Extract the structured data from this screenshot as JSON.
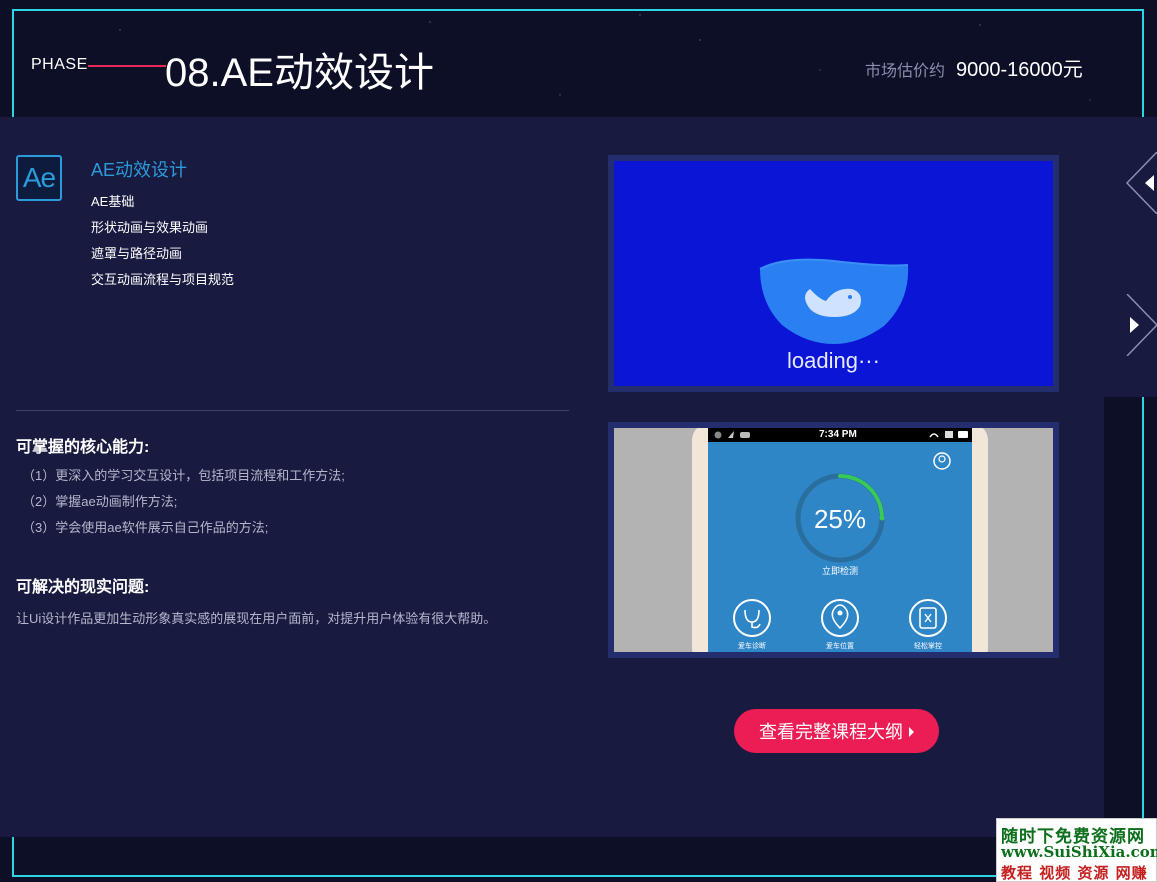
{
  "header": {
    "phase_label": "PHASE",
    "title": "08.AE动效设计",
    "price_label": "市场估价约",
    "price_value": "9000-16000元"
  },
  "module": {
    "icon_text": "Ae",
    "title": "AE动效设计",
    "items": [
      "AE基础",
      "形状动画与效果动画",
      "遮罩与路径动画",
      "交互动画流程与项目规范"
    ]
  },
  "core": {
    "heading": "可掌握的核心能力:",
    "items": [
      "（1）更深入的学习交互设计，包括项目流程和工作方法;",
      "（2）掌握ae动画制作方法;",
      "（3）学会使用ae软件展示自己作品的方法;"
    ]
  },
  "solve": {
    "heading": "可解决的现实问题:",
    "text": "让Ui设计作品更加生动形象真实感的展现在用户面前，对提升用户体验有很大帮助。"
  },
  "preview_loading": {
    "text": "loading···",
    "bg_color": "#0a15d6"
  },
  "preview_phone": {
    "time": "7:34 PM",
    "percent": "25%",
    "progress": 0.25,
    "detect_label": "立即检测",
    "tabs": [
      "爱车诊断",
      "爱车位置",
      "轻松掌控"
    ]
  },
  "cta": {
    "label": "查看完整课程大纲"
  },
  "watermark": {
    "line1": "随时下免费资源网",
    "line2": "www.SuiShiXia.com",
    "line3": "教程 视频 资源 网赚"
  },
  "colors": {
    "accent_cyan": "#2fd3e6",
    "accent_red": "#e8295a",
    "cta_pink": "#ec1d54",
    "ae_blue": "#2b9bd9",
    "panel_bg": "#181a40"
  }
}
